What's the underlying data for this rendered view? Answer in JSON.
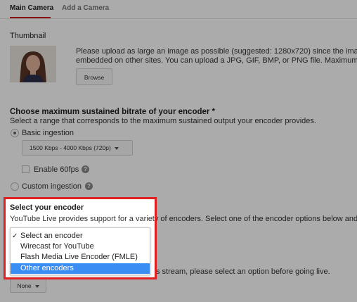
{
  "tabs": [
    {
      "label": "Main Camera",
      "active": true
    },
    {
      "label": "Add a Camera",
      "active": false
    }
  ],
  "thumbnail": {
    "title": "Thumbnail",
    "line1": "Please upload as large an image as possible (suggested: 1280x720) since the ima",
    "line2": "embedded on other sites. You can upload a JPG, GIF, BMP, or PNG file. Maximum f",
    "browse_label": "Browse"
  },
  "bitrate": {
    "title": "Choose maximum sustained bitrate of your encoder *",
    "description": "Select a range that corresponds to the maximum sustained output your encoder provides.",
    "basic_label": "Basic ingestion",
    "basic_selected": true,
    "dropdown_value": "1500 Kbps - 4000 Kbps (720p)",
    "enable60_label": "Enable 60fps",
    "custom_label": "Custom ingestion",
    "help_glyph": "?"
  },
  "encoder": {
    "title": "Select your encoder",
    "description": "YouTube Live provides support for a variety of encoders. Select one of the encoder options below and",
    "check_glyph": "✓",
    "options": [
      {
        "label": "Select an encoder",
        "checked": true,
        "highlighted": false
      },
      {
        "label": "Wirecast for YouTube",
        "checked": false,
        "highlighted": false
      },
      {
        "label": "Flash Media Live Encoder (FMLE)",
        "checked": false,
        "highlighted": false
      },
      {
        "label": "Other encoders",
        "checked": false,
        "highlighted": true
      }
    ]
  },
  "stream": {
    "partial_text": "s stream, please select an option before going live.",
    "none_label": "None"
  },
  "colors": {
    "highlight_border": "#e02020",
    "menu_selected": "#3a8ef3",
    "tab_underline": "#cc181e"
  },
  "icons": [
    "help-icon",
    "checkmark-icon",
    "chevron-down-icon"
  ]
}
